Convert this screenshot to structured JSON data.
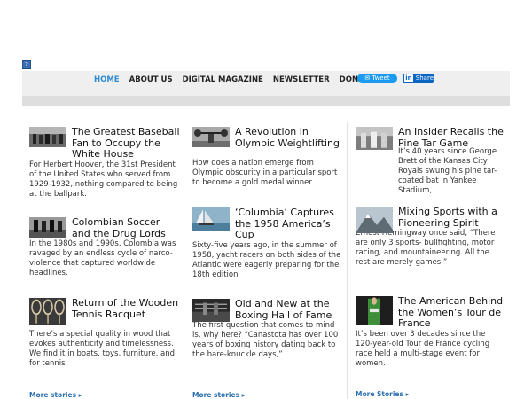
{
  "nav": {
    "items": [
      "HOME",
      "ABOUT US",
      "DIGITAL MAGAZINE",
      "NEWSLETTER",
      "DONATION"
    ],
    "tweet_label": "Tweet",
    "share_label": "Share"
  },
  "columns": [
    {
      "articles": [
        {
          "title": "The Greatest Baseball Fan to Occupy the White House",
          "desc": "For Herbert Hoover, the 31st President of the United States who served from 1929-1932, nothing compared to being at the ballpark."
        },
        {
          "title": "Colombian Soccer and the Drug Lords",
          "desc": "In the 1980s and 1990s, Colombia was ravaged by an endless cycle of narco-violence that captured worldwide headlines."
        },
        {
          "title": "Return of the Wooden Tennis Racquet",
          "desc": "There’s a special quality in wood that evokes authenticity and timelessness. We find it in boats, toys, furniture, and for tennis"
        }
      ],
      "more_label": "More stories"
    },
    {
      "articles": [
        {
          "title": "A Revolution in Olympic Weightlifting",
          "desc": "How does a nation emerge from Olympic obscurity in a particular sport to become a gold medal winner"
        },
        {
          "title": "‘Columbia’ Captures the 1958 America’s Cup",
          "desc": "Sixty-five years ago, in the summer of 1958, yacht racers on both sides of the Atlantic were eagerly preparing for the 18th edition"
        },
        {
          "title": "Old and New at the Boxing Hall of Fame",
          "desc": "The first question that comes to mind is, why here? “Canastota has over 100 years of boxing history dating back to the bare-knuckle days,”"
        }
      ],
      "more_label": "More stories"
    },
    {
      "articles": [
        {
          "title": "An Insider Recalls the Pine Tar Game",
          "desc": "It’s 40 years since George Brett of the Kansas City Royals swung his pine tar-coated bat in Yankee Stadium,"
        },
        {
          "title": "Mixing Sports with a Pioneering Spirit",
          "desc": "Ernest Hemingway once said, “There are only 3 sports- bullfighting, motor racing, and mountaineering. All the rest are merely games.”"
        },
        {
          "title": "The American Behind the Women’s Tour de France",
          "desc": "It’s been over 3 decades since the 120-year-old Tour de France cycling race held a multi-stage event for women."
        }
      ],
      "more_label": "More Stories"
    }
  ],
  "colors": {
    "accent": "#2a8ad4",
    "link": "#2a6fb0",
    "tweet": "#1d9bf0",
    "linkedin": "#0a66c2"
  },
  "thumb_icons": [
    "baseball-photo",
    "weightlifting-photo",
    "pine-tar-photo",
    "soccer-photo",
    "yacht-photo",
    "mountaineering-photo",
    "tennis-racquets-photo",
    "boxing-photo",
    "cyclist-photo"
  ]
}
